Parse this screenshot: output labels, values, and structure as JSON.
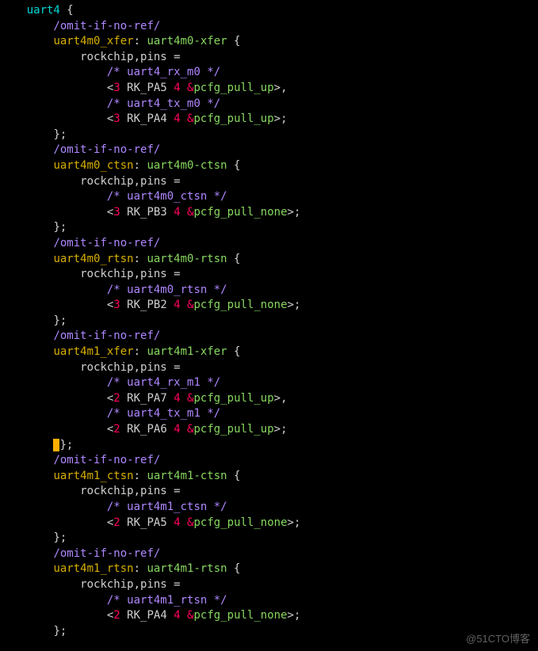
{
  "indent": {
    "l1": "    ",
    "l2": "        ",
    "l3": "            ",
    "l4": "                "
  },
  "node": {
    "name": "uart4",
    "open": " {",
    "close": "};"
  },
  "common": {
    "omit": "/omit-if-no-ref/",
    "pins_key": "rockchip,pins",
    "equals": " =",
    "angle_open": "<",
    "three": "3",
    "two": "2",
    "num4": "4",
    "amp": "&",
    "close_comma": ">,",
    "close_semi": ">;",
    "comment_open": "/* ",
    "comment_close": " */"
  },
  "subs": {
    "m0x": {
      "label": "uart4m0_xfer",
      "node": "uart4m0-xfer",
      "c1": "uart4_rx_m0",
      "p1": "RK_PA5",
      "r1": "pcfg_pull_up",
      "c2": "uart4_tx_m0",
      "p2": "RK_PA4",
      "r2": "pcfg_pull_up",
      "bank": "3"
    },
    "m0c": {
      "label": "uart4m0_ctsn",
      "node": "uart4m0-ctsn",
      "c1": "uart4m0_ctsn",
      "p1": "RK_PB3",
      "r1": "pcfg_pull_none",
      "bank": "3"
    },
    "m0r": {
      "label": "uart4m0_rtsn",
      "node": "uart4m0-rtsn",
      "c1": "uart4m0_rtsn",
      "p1": "RK_PB2",
      "r1": "pcfg_pull_none",
      "bank": "3"
    },
    "m1x": {
      "label": "uart4m1_xfer",
      "node": "uart4m1-xfer",
      "c1": "uart4_rx_m1",
      "p1": "RK_PA7",
      "r1": "pcfg_pull_up",
      "c2": "uart4_tx_m1",
      "p2": "RK_PA6",
      "r2": "pcfg_pull_up",
      "bank": "2"
    },
    "m1c": {
      "label": "uart4m1_ctsn",
      "node": "uart4m1-ctsn",
      "c1": "uart4m1_ctsn",
      "p1": "RK_PA5",
      "r1": "pcfg_pull_none",
      "bank": "2"
    },
    "m1r": {
      "label": "uart4m1_rtsn",
      "node": "uart4m1-rtsn",
      "c1": "uart4m1_rtsn",
      "p1": "RK_PA4",
      "r1": "pcfg_pull_none",
      "bank": "2"
    }
  },
  "watermark": "@51CTO博客"
}
